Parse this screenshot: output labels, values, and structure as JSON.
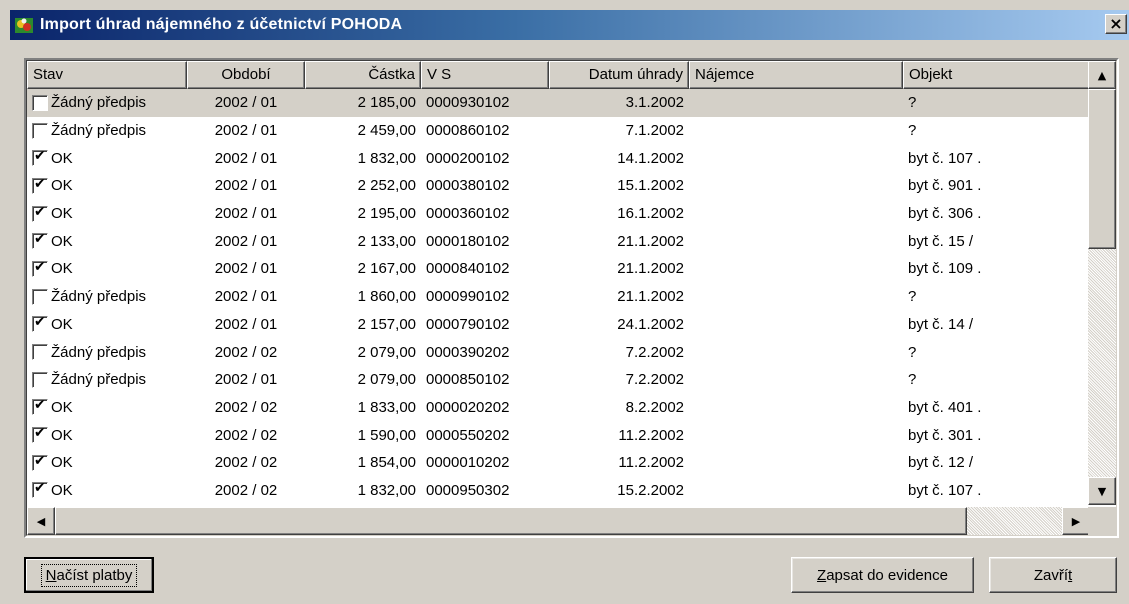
{
  "window": {
    "title": "Import úhrad nájemného z účetnictví POHODA",
    "close_label": "×"
  },
  "grid": {
    "columns": [
      {
        "label": "Stav",
        "align": "left"
      },
      {
        "label": "Období",
        "align": "center"
      },
      {
        "label": "Částka",
        "align": "right"
      },
      {
        "label": "V S",
        "align": "left"
      },
      {
        "label": "Datum úhrady",
        "align": "right"
      },
      {
        "label": "Nájemce",
        "align": "left"
      },
      {
        "label": "Objekt",
        "align": "left"
      }
    ],
    "rows": [
      {
        "checked": false,
        "stav": "Žádný předpis",
        "obdobi": "2002 / 01",
        "castka": "2 185,00",
        "vs": "0000930102",
        "datum": "3.1.2002",
        "najemce": "",
        "objekt": "?",
        "selected": true
      },
      {
        "checked": false,
        "stav": "Žádný předpis",
        "obdobi": "2002 / 01",
        "castka": "2 459,00",
        "vs": "0000860102",
        "datum": "7.1.2002",
        "najemce": "",
        "objekt": "?"
      },
      {
        "checked": true,
        "stav": "OK",
        "obdobi": "2002 / 01",
        "castka": "1 832,00",
        "vs": "0000200102",
        "datum": "14.1.2002",
        "najemce": "",
        "objekt": "byt č. 107 ."
      },
      {
        "checked": true,
        "stav": "OK",
        "obdobi": "2002 / 01",
        "castka": "2 252,00",
        "vs": "0000380102",
        "datum": "15.1.2002",
        "najemce": "",
        "objekt": "byt č. 901 ."
      },
      {
        "checked": true,
        "stav": "OK",
        "obdobi": "2002 / 01",
        "castka": "2 195,00",
        "vs": "0000360102",
        "datum": "16.1.2002",
        "najemce": "",
        "objekt": "byt č. 306 ."
      },
      {
        "checked": true,
        "stav": "OK",
        "obdobi": "2002 / 01",
        "castka": "2 133,00",
        "vs": "0000180102",
        "datum": "21.1.2002",
        "najemce": "",
        "objekt": "byt č. 15 /"
      },
      {
        "checked": true,
        "stav": "OK",
        "obdobi": "2002 / 01",
        "castka": "2 167,00",
        "vs": "0000840102",
        "datum": "21.1.2002",
        "najemce": "",
        "objekt": "byt č. 109 ."
      },
      {
        "checked": false,
        "stav": "Žádný předpis",
        "obdobi": "2002 / 01",
        "castka": "1 860,00",
        "vs": "0000990102",
        "datum": "21.1.2002",
        "najemce": "",
        "objekt": "?"
      },
      {
        "checked": true,
        "stav": "OK",
        "obdobi": "2002 / 01",
        "castka": "2 157,00",
        "vs": "0000790102",
        "datum": "24.1.2002",
        "najemce": "",
        "objekt": "byt č. 14 /"
      },
      {
        "checked": false,
        "stav": "Žádný předpis",
        "obdobi": "2002 / 02",
        "castka": "2 079,00",
        "vs": "0000390202",
        "datum": "7.2.2002",
        "najemce": "",
        "objekt": "?"
      },
      {
        "checked": false,
        "stav": "Žádný předpis",
        "obdobi": "2002 / 01",
        "castka": "2 079,00",
        "vs": "0000850102",
        "datum": "7.2.2002",
        "najemce": "",
        "objekt": "?"
      },
      {
        "checked": true,
        "stav": "OK",
        "obdobi": "2002 / 02",
        "castka": "1 833,00",
        "vs": "0000020202",
        "datum": "8.2.2002",
        "najemce": "",
        "objekt": "byt č. 401 ."
      },
      {
        "checked": true,
        "stav": "OK",
        "obdobi": "2002 / 02",
        "castka": "1 590,00",
        "vs": "0000550202",
        "datum": "11.2.2002",
        "najemce": "",
        "objekt": "byt č. 301 ."
      },
      {
        "checked": true,
        "stav": "OK",
        "obdobi": "2002 / 02",
        "castka": "1 854,00",
        "vs": "0000010202",
        "datum": "11.2.2002",
        "najemce": "",
        "objekt": "byt č. 12 /"
      },
      {
        "checked": true,
        "stav": "OK",
        "obdobi": "2002 / 02",
        "castka": "1 832,00",
        "vs": "0000950302",
        "datum": "15.2.2002",
        "najemce": "",
        "objekt": "byt č. 107 ."
      }
    ]
  },
  "buttons": {
    "load": {
      "mnemonic": "N",
      "rest": "ačíst platby"
    },
    "write": {
      "mnemonic": "Z",
      "rest": "apsat do evidence"
    },
    "close": {
      "before": "Zavří",
      "mnemonic": "t"
    }
  },
  "icons": {
    "window": "app-icon",
    "scroll_up": "▲",
    "scroll_down": "▼",
    "scroll_left": "◀",
    "scroll_right": "▶"
  }
}
